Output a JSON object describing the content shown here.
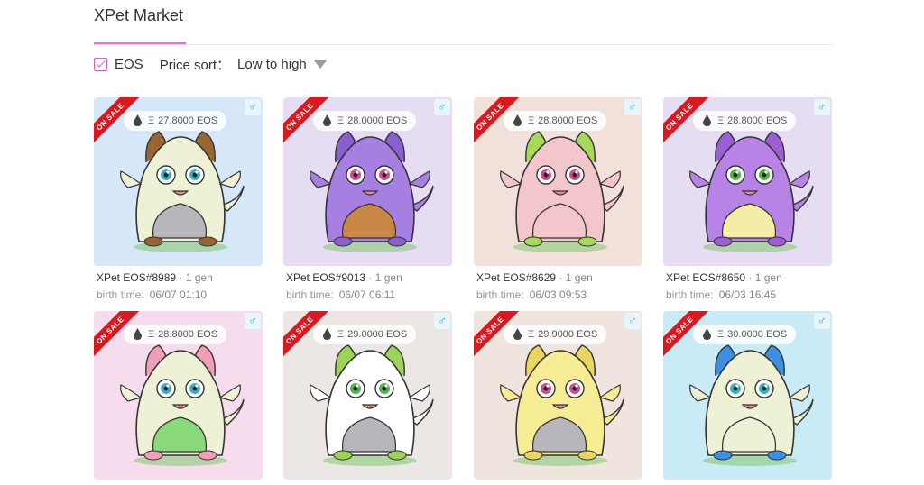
{
  "header": {
    "title": "XPet Market"
  },
  "filters": {
    "currency_label": "EOS",
    "sort_label": "Price sort：",
    "sort_value": "Low to high"
  },
  "card_common": {
    "ribbon": "ON SALE",
    "currency_symbol": "Ξ",
    "gender_symbol": "♂",
    "birth_label": "birth time:"
  },
  "cards": [
    {
      "name": "XPet EOS#8989",
      "gen": "· 1 gen",
      "price": "27.8000 EOS",
      "birth": "06/07 01:10",
      "bg": "#d6e7f9",
      "body": "#eef1d6",
      "belly": "#b8b6bb",
      "accent": "#9a6535",
      "eye": "#36b0c5"
    },
    {
      "name": "XPet EOS#9013",
      "gen": "· 1 gen",
      "price": "28.0000 EOS",
      "birth": "06/07 06:11",
      "bg": "#e6ddf3",
      "body": "#a77fe0",
      "belly": "#c98847",
      "accent": "#8a5fd0",
      "eye": "#d04a8e"
    },
    {
      "name": "XPet EOS#8629",
      "gen": "· 1 gen",
      "price": "28.8000 EOS",
      "birth": "06/03 09:53",
      "bg": "#f1e1da",
      "body": "#f3c6cb",
      "belly": "#f3c6cb",
      "accent": "#a6d957",
      "eye": "#d04a8e"
    },
    {
      "name": "XPet EOS#8650",
      "gen": "· 1 gen",
      "price": "28.8000 EOS",
      "birth": "06/03 16:45",
      "bg": "#e6ddf3",
      "body": "#b783e6",
      "belly": "#f5eda6",
      "accent": "#9b5ed4",
      "eye": "#4fb14a"
    },
    {
      "name": "",
      "gen": "",
      "price": "28.8000 EOS",
      "birth": "",
      "bg": "#f7dced",
      "body": "#eef1d6",
      "belly": "#8ad97a",
      "accent": "#ef9fb8",
      "eye": "#36b0c5"
    },
    {
      "name": "",
      "gen": "",
      "price": "29.0000 EOS",
      "birth": "",
      "bg": "#ece6e4",
      "body": "#ffffff",
      "belly": "#b8b6bb",
      "accent": "#9ed35a",
      "eye": "#4fb14a"
    },
    {
      "name": "",
      "gen": "",
      "price": "29.9000 EOS",
      "birth": "",
      "bg": "#f0e4df",
      "body": "#f6ec93",
      "belly": "#b8b6bb",
      "accent": "#e8d562",
      "eye": "#d04a8e"
    },
    {
      "name": "",
      "gen": "",
      "price": "30.0000 EOS",
      "birth": "",
      "bg": "#c9ebf6",
      "body": "#eef1d6",
      "belly": "#eef1d6",
      "accent": "#3d8fe0",
      "eye": "#36b0c5"
    }
  ]
}
